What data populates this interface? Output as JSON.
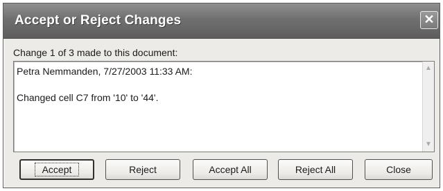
{
  "window": {
    "title": "Accept or Reject Changes",
    "close_glyph": "✕"
  },
  "prompt": "Change 1 of 3 made to this document:",
  "change_details": {
    "author_line": "Petra Nemmanden, 7/27/2003 11:33 AM:",
    "description": "Changed cell C7 from '10' to '44'."
  },
  "scrollbar": {
    "up_arrow": "▲",
    "down_arrow": "▼"
  },
  "buttons": {
    "accept": "Accept",
    "reject": "Reject",
    "accept_all": "Accept All",
    "reject_all": "Reject All",
    "close": "Close"
  }
}
